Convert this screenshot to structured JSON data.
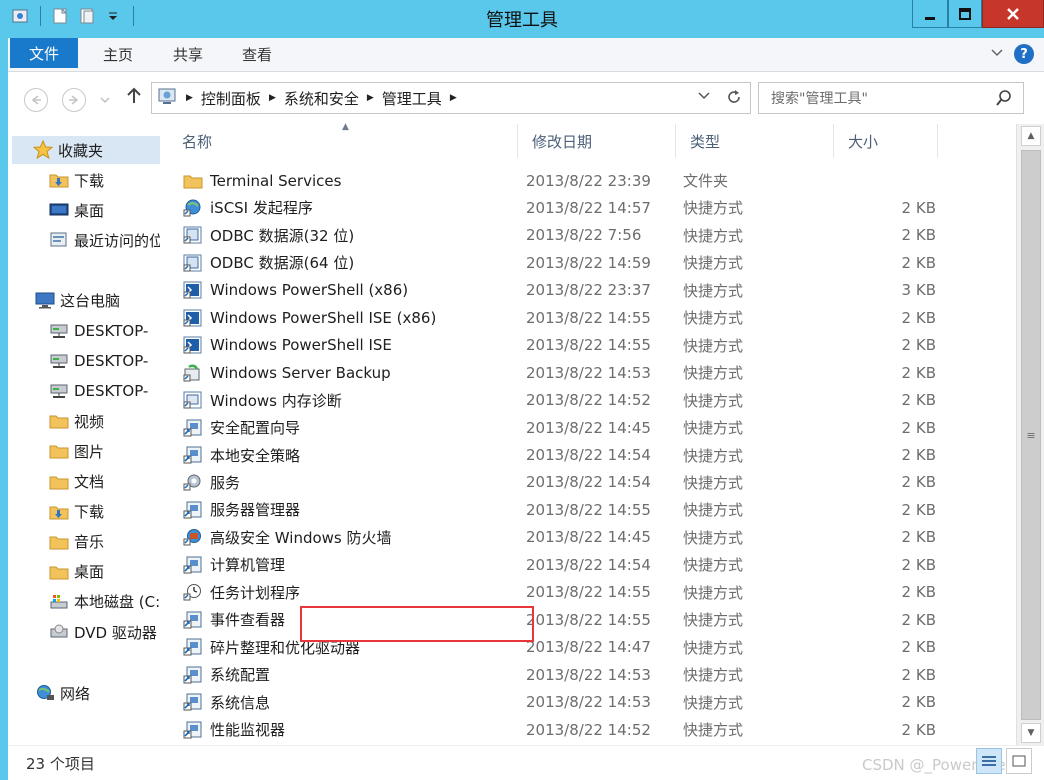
{
  "window": {
    "title": "管理工具"
  },
  "qat": {
    "icons": [
      "properties-icon",
      "new-folder-icon",
      "doc-icon",
      "customize-dropdown-icon"
    ]
  },
  "ribbon": {
    "tabs": [
      {
        "id": "file",
        "label": "文件"
      },
      {
        "id": "home",
        "label": "主页"
      },
      {
        "id": "share",
        "label": "共享"
      },
      {
        "id": "view",
        "label": "查看"
      }
    ]
  },
  "address": {
    "crumbs": [
      "控制面板",
      "系统和安全",
      "管理工具"
    ]
  },
  "search": {
    "placeholder": "搜索\"管理工具\""
  },
  "nav": {
    "favorites": "收藏夹",
    "items": [
      {
        "label": "下载",
        "icon": "download-folder-icon"
      },
      {
        "label": "桌面",
        "icon": "desktop-icon"
      },
      {
        "label": "最近访问的位置",
        "icon": "recent-icon"
      }
    ],
    "this_pc": "这台电脑",
    "pc_items": [
      {
        "label": "DESKTOP-",
        "icon": "network-drive-icon"
      },
      {
        "label": "DESKTOP-",
        "icon": "network-drive-icon"
      },
      {
        "label": "DESKTOP-",
        "icon": "network-drive-icon"
      },
      {
        "label": "视频",
        "icon": "folder-icon"
      },
      {
        "label": "图片",
        "icon": "folder-icon"
      },
      {
        "label": "文档",
        "icon": "folder-icon"
      },
      {
        "label": "下载",
        "icon": "download-folder-icon"
      },
      {
        "label": "音乐",
        "icon": "folder-icon"
      },
      {
        "label": "桌面",
        "icon": "folder-icon"
      },
      {
        "label": "本地磁盘 (C:)",
        "icon": "local-disk-icon"
      },
      {
        "label": "DVD 驱动器",
        "icon": "dvd-drive-icon"
      }
    ],
    "network": "网络"
  },
  "columns": {
    "name": "名称",
    "date": "修改日期",
    "type": "类型",
    "size": "大小"
  },
  "files": [
    {
      "name": "Terminal Services",
      "date": "2013/8/22 23:39",
      "type": "文件夹",
      "size": "",
      "icon": "folder-icon"
    },
    {
      "name": "iSCSI 发起程序",
      "date": "2013/8/22 14:57",
      "type": "快捷方式",
      "size": "2 KB",
      "icon": "iscsi-icon"
    },
    {
      "name": "ODBC 数据源(32 位)",
      "date": "2013/8/22 7:56",
      "type": "快捷方式",
      "size": "2 KB",
      "icon": "odbc-icon"
    },
    {
      "name": "ODBC 数据源(64 位)",
      "date": "2013/8/22 14:59",
      "type": "快捷方式",
      "size": "2 KB",
      "icon": "odbc-icon"
    },
    {
      "name": "Windows PowerShell (x86)",
      "date": "2013/8/22 23:37",
      "type": "快捷方式",
      "size": "3 KB",
      "icon": "powershell-icon"
    },
    {
      "name": "Windows PowerShell ISE (x86)",
      "date": "2013/8/22 14:55",
      "type": "快捷方式",
      "size": "2 KB",
      "icon": "powershell-icon"
    },
    {
      "name": "Windows PowerShell ISE",
      "date": "2013/8/22 14:55",
      "type": "快捷方式",
      "size": "2 KB",
      "icon": "powershell-icon"
    },
    {
      "name": "Windows Server Backup",
      "date": "2013/8/22 14:53",
      "type": "快捷方式",
      "size": "2 KB",
      "icon": "backup-icon"
    },
    {
      "name": "Windows 内存诊断",
      "date": "2013/8/22 14:52",
      "type": "快捷方式",
      "size": "2 KB",
      "icon": "memory-diagnostic-icon"
    },
    {
      "name": "安全配置向导",
      "date": "2013/8/22 14:45",
      "type": "快捷方式",
      "size": "2 KB",
      "icon": "shortcut-icon"
    },
    {
      "name": "本地安全策略",
      "date": "2013/8/22 14:54",
      "type": "快捷方式",
      "size": "2 KB",
      "icon": "shortcut-icon"
    },
    {
      "name": "服务",
      "date": "2013/8/22 14:54",
      "type": "快捷方式",
      "size": "2 KB",
      "icon": "services-icon"
    },
    {
      "name": "服务器管理器",
      "date": "2013/8/22 14:55",
      "type": "快捷方式",
      "size": "2 KB",
      "icon": "shortcut-icon"
    },
    {
      "name": "高级安全 Windows 防火墙",
      "date": "2013/8/22 14:45",
      "type": "快捷方式",
      "size": "2 KB",
      "icon": "firewall-icon"
    },
    {
      "name": "计算机管理",
      "date": "2013/8/22 14:54",
      "type": "快捷方式",
      "size": "2 KB",
      "icon": "shortcut-icon"
    },
    {
      "name": "任务计划程序",
      "date": "2013/8/22 14:55",
      "type": "快捷方式",
      "size": "2 KB",
      "icon": "task-scheduler-icon"
    },
    {
      "name": "事件查看器",
      "date": "2013/8/22 14:55",
      "type": "快捷方式",
      "size": "2 KB",
      "icon": "shortcut-icon"
    },
    {
      "name": "碎片整理和优化驱动器",
      "date": "2013/8/22 14:47",
      "type": "快捷方式",
      "size": "2 KB",
      "icon": "shortcut-icon"
    },
    {
      "name": "系统配置",
      "date": "2013/8/22 14:53",
      "type": "快捷方式",
      "size": "2 KB",
      "icon": "shortcut-icon"
    },
    {
      "name": "系统信息",
      "date": "2013/8/22 14:53",
      "type": "快捷方式",
      "size": "2 KB",
      "icon": "shortcut-icon"
    },
    {
      "name": "性能监视器",
      "date": "2013/8/22 14:52",
      "type": "快捷方式",
      "size": "2 KB",
      "icon": "shortcut-icon"
    }
  ],
  "status": {
    "count": "23 个项目"
  },
  "watermark": "CSDN @_PowerShell",
  "colors": {
    "titlebar": "#5ac8eb",
    "file_tab": "#1979ca",
    "close": "#c7362b",
    "highlight": "#e8363a"
  }
}
